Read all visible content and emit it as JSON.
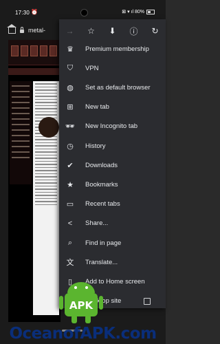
{
  "status_bar": {
    "time": "17:30",
    "alarm_icon": "alarm-icon",
    "right_icons": "⊠ ▾ ıl 80%"
  },
  "browser": {
    "url": "metal-"
  },
  "menu": {
    "toolbar": [
      {
        "name": "forward-button",
        "glyph": "→",
        "disabled": true
      },
      {
        "name": "bookmark-star-button",
        "glyph": "☆"
      },
      {
        "name": "download-button",
        "glyph": "⬇"
      },
      {
        "name": "page-info-button",
        "glyph": "ⓘ"
      },
      {
        "name": "reload-button",
        "glyph": "↻"
      }
    ],
    "items": [
      {
        "label": "Premium membership",
        "icon": "crown-icon"
      },
      {
        "label": "VPN",
        "icon": "shield-icon"
      },
      {
        "label": "Set as default browser",
        "icon": "globe-icon"
      },
      {
        "label": "New tab",
        "icon": "plus-box-icon"
      },
      {
        "label": "New Incognito tab",
        "icon": "incognito-icon"
      },
      {
        "label": "History",
        "icon": "history-icon"
      },
      {
        "label": "Downloads",
        "icon": "download-check-icon"
      },
      {
        "label": "Bookmarks",
        "icon": "star-icon"
      },
      {
        "label": "Recent tabs",
        "icon": "recent-tabs-icon"
      },
      {
        "label": "Share...",
        "icon": "share-icon"
      },
      {
        "label": "Find in page",
        "icon": "find-icon"
      },
      {
        "label": "Translate...",
        "icon": "translate-icon"
      },
      {
        "label": "Add to Home screen",
        "icon": "add-home-icon"
      },
      {
        "label": "Desktop site",
        "icon": "desktop-icon",
        "checkbox": true
      }
    ]
  },
  "watermark": {
    "text": "OceanofAPK.com",
    "badge": "APK"
  }
}
